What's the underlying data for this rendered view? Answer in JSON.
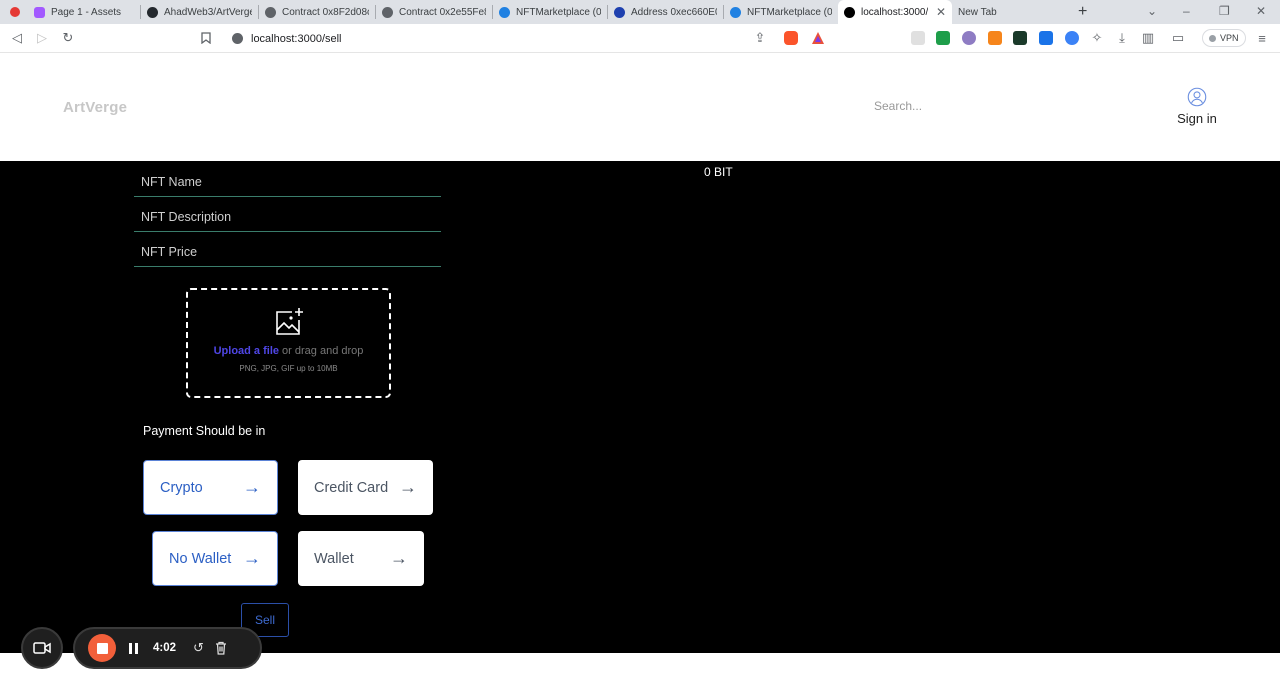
{
  "browser": {
    "tabs": [
      {
        "label": "Page 1 - Assets",
        "icon": "figma-icon",
        "color": "#a259ff",
        "active": false
      },
      {
        "label": "AhadWeb3/ArtVerge",
        "icon": "github-icon",
        "color": "#24292e",
        "active": false
      },
      {
        "label": "Contract 0x8F2d08c",
        "icon": "etherscan-icon",
        "color": "#5f6368",
        "active": false
      },
      {
        "label": "Contract 0x2e55Fe8",
        "icon": "etherscan-icon",
        "color": "#5f6368",
        "active": false
      },
      {
        "label": "NFTMarketplace (0x",
        "icon": "opensea-icon",
        "color": "#2081e2",
        "active": false
      },
      {
        "label": "Address 0xec660E0e",
        "icon": "explorer-icon",
        "color": "#1e40af",
        "active": false
      },
      {
        "label": "NFTMarketplace (0x",
        "icon": "opensea-icon",
        "color": "#2081e2",
        "active": false
      },
      {
        "label": "localhost:3000/",
        "icon": "vercel-icon",
        "color": "#000000",
        "active": true
      },
      {
        "label": "New Tab",
        "icon": "",
        "color": "",
        "active": false
      }
    ],
    "url": "localhost:3000/sell",
    "vpn_label": "VPN"
  },
  "header": {
    "logo": "ArtVerge",
    "search_placeholder": "Search...",
    "signin_label": "Sign in"
  },
  "form": {
    "name_placeholder": "NFT Name",
    "description_placeholder": "NFT Description",
    "price_placeholder": "NFT Price",
    "balance": "0 BIT",
    "upload": {
      "link": "Upload a file",
      "text": " or drag and drop",
      "hint": "PNG, JPG, GIF up to 10MB"
    },
    "payment_label": "Payment Should be in",
    "payment_options": [
      {
        "label": "Crypto",
        "selected": true
      },
      {
        "label": "Credit Card",
        "selected": false
      }
    ],
    "wallet_options": [
      {
        "label": "No Wallet",
        "selected": true
      },
      {
        "label": "Wallet",
        "selected": false
      }
    ],
    "arrow": "→",
    "sell_label": "Sell"
  },
  "recorder": {
    "time": "4:02"
  },
  "colors": {
    "accent": "#2b5fc4",
    "upload_link": "#4f46e5",
    "record": "#f25f3a",
    "field_border": "#3a7d6b"
  }
}
